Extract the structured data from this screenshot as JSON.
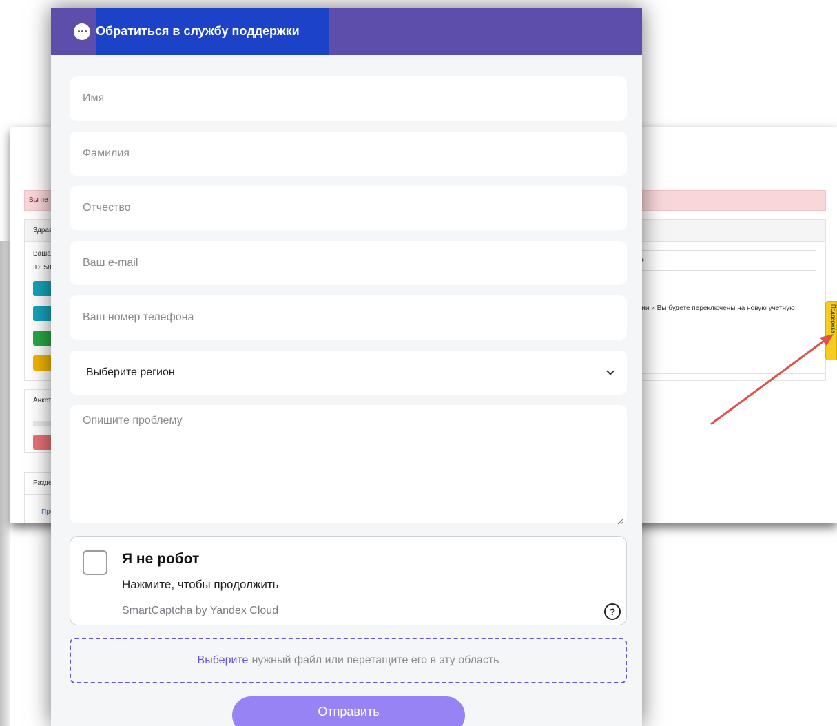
{
  "modal": {
    "title": "Обратиться в службу поддержки",
    "icon": "chat-icon"
  },
  "form": {
    "first_name_placeholder": "Имя",
    "last_name_placeholder": "Фамилия",
    "patronymic_placeholder": "Отчество",
    "email_placeholder": "Ваш e-mail",
    "phone_placeholder": "Ваш номер телефона",
    "region_selected": "Выберите регион",
    "problem_placeholder": "Опишите проблему"
  },
  "captcha": {
    "title": "Я не робот",
    "subtitle": "Нажмите, чтобы продолжить",
    "brand": "SmartCaptcha by Yandex Cloud",
    "help": "?"
  },
  "dropzone": {
    "pick_label": "Выберите",
    "rest_label": "нужный файл или перетащите его в эту область"
  },
  "submit_label": "Отправить",
  "background": {
    "alert_text": "Вы не",
    "panel1_head": "Здрав",
    "panel1_line1": "Ваша",
    "panel1_line2": "ID: 587",
    "panel2_head": "Анкет",
    "panel3_head": "Разде",
    "link_text": "Пре",
    "right_box_text": "я",
    "right_text": "ации и Вы будете переключены на новую учетную",
    "support_tab": "Поддержка"
  },
  "colors": {
    "header": "#5d4eac",
    "header_highlight": "#1c42c7",
    "accent": "#6a55d8",
    "submit": "#9883f5",
    "support_tab": "#f5cc1f",
    "arrow": "#e0504a"
  }
}
